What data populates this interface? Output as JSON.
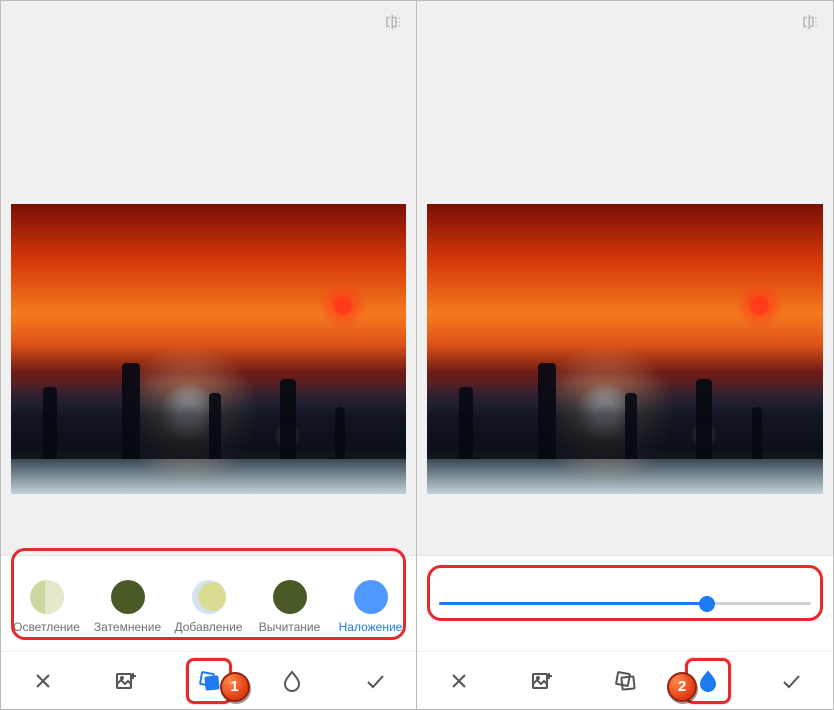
{
  "left": {
    "blendModes": [
      {
        "key": "lighten",
        "label": "Осветление",
        "cls": "c-lighten",
        "active": false
      },
      {
        "key": "darken",
        "label": "Затемнение",
        "cls": "c-darken",
        "active": false
      },
      {
        "key": "add",
        "label": "Добавление",
        "cls": "c-add",
        "active": false
      },
      {
        "key": "subtract",
        "label": "Вычитание",
        "cls": "c-subtract",
        "active": false
      },
      {
        "key": "overlay",
        "label": "Наложение",
        "cls": "c-overlay",
        "active": true
      }
    ],
    "callout": "1"
  },
  "right": {
    "opacity": {
      "value": 72,
      "min": 0,
      "max": 100
    },
    "callout": "2"
  }
}
